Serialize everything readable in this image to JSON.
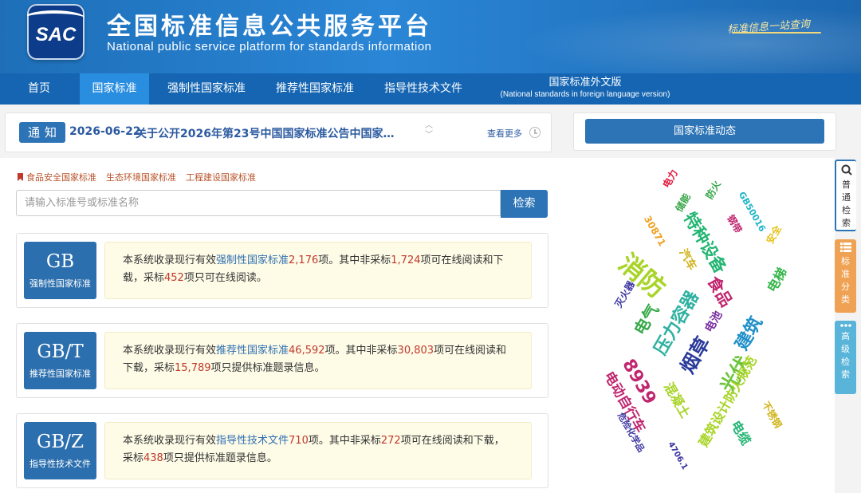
{
  "header": {
    "logo_text": "SAC",
    "title_cn": "全国标准信息公共服务平台",
    "title_en": "National public service platform  for standards information",
    "slogan": "标准信息一站查询"
  },
  "nav": {
    "items": [
      "首页",
      "国家标准",
      "强制性国家标准",
      "推荐性国家标准",
      "指导性技术文件"
    ],
    "foreign_cn": "国家标准外文版",
    "foreign_en": "(National standards in foreign language version)"
  },
  "notice": {
    "badge": "通知",
    "date": "2026-06-22",
    "text": "关于公开2026年第23号中国国家标准公告中国家…",
    "more": "查看更多"
  },
  "news": {
    "button": "国家标准动态"
  },
  "quick_links": [
    "食品安全国家标准",
    "生态环境国家标准",
    "工程建设国家标准"
  ],
  "search": {
    "placeholder": "请输入标准号或标准名称",
    "button": "检索"
  },
  "cards": [
    {
      "code": "GB",
      "sub": "强制性国家标准",
      "prefix": "本系统收录现行有效",
      "type": "强制性国家标准",
      "total": "2,176",
      "p2": "项。其中非采标",
      "n1": "1,724",
      "p3": "项可在线阅读和下载，采标",
      "n2": "452",
      "p4": "项只可在线阅读。"
    },
    {
      "code": "GB/T",
      "sub": "推荐性国家标准",
      "prefix": "本系统收录现行有效",
      "type": "推荐性国家标准",
      "total": "46,592",
      "p2": "项。其中非采标",
      "n1": "30,803",
      "p3": "项可在线阅读和下载，采标",
      "n2": "15,789",
      "p4": "项只提供标准题录信息。"
    },
    {
      "code": "GB/Z",
      "sub": "指导性技术文件",
      "prefix": "本系统收录现行有效",
      "type": "指导性技术文件",
      "total": "710",
      "p2": "项。其中非采标",
      "n1": "272",
      "p3": "项可在线阅读和下载，采标",
      "n2": "438",
      "p4": "项只提供标准题录信息。"
    }
  ],
  "word_cloud": [
    {
      "w": "电力",
      "c": "#e0193a"
    },
    {
      "w": "储能",
      "c": "#3aa64a"
    },
    {
      "w": "防火",
      "c": "#3aa64a"
    },
    {
      "w": "GB50016",
      "c": "#1fb4c9"
    },
    {
      "w": "30871",
      "c": "#f0a020"
    },
    {
      "w": "特种设备",
      "c": "#24b573"
    },
    {
      "w": "钢带",
      "c": "#c0256e"
    },
    {
      "w": "安全",
      "c": "#e6c21a"
    },
    {
      "w": "消防",
      "c": "#a8d427"
    },
    {
      "w": "汽车",
      "c": "#d0b41c"
    },
    {
      "w": "食品",
      "c": "#c0256e"
    },
    {
      "w": "电梯",
      "c": "#35b64a"
    },
    {
      "w": "灭火器",
      "c": "#3a34a0"
    },
    {
      "w": "电气",
      "c": "#38a94a"
    },
    {
      "w": "压力容器",
      "c": "#2fb1a0"
    },
    {
      "w": "电池",
      "c": "#7a2fa0"
    },
    {
      "w": "建筑",
      "c": "#1f8fc9"
    },
    {
      "w": "烟草",
      "c": "#2a3a9a"
    },
    {
      "w": "8939",
      "c": "#c0256e"
    },
    {
      "w": "光伏",
      "c": "#6cc43a"
    },
    {
      "w": "电动自行车",
      "c": "#c0256e"
    },
    {
      "w": "混凝土",
      "c": "#a8d427"
    },
    {
      "w": "建筑设计防火规范",
      "c": "#a8d427"
    },
    {
      "w": "不锈钢",
      "c": "#d0b41c"
    },
    {
      "w": "危险化学品",
      "c": "#3a34a0"
    },
    {
      "w": "电缆",
      "c": "#24b573"
    },
    {
      "w": "4706.1",
      "c": "#3a34a0"
    }
  ],
  "side_tabs": [
    {
      "label": "普通检索",
      "icon": "search-icon"
    },
    {
      "label": "标准分类",
      "icon": "list-icon"
    },
    {
      "label": "高级检索",
      "icon": "more-icon"
    }
  ],
  "colors": {
    "primary": "#2c74b6",
    "nav": "#1565b2",
    "highlight_num": "#c0392b",
    "side_orange": "#f0a254",
    "side_blue": "#58b4d8"
  }
}
